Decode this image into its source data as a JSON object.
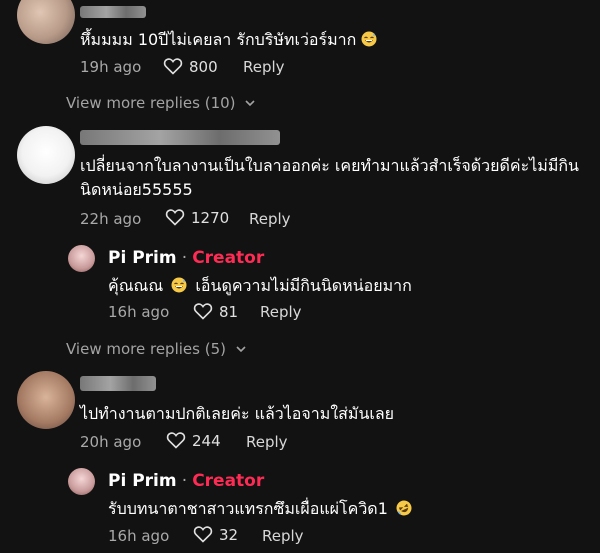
{
  "comments": [
    {
      "text": "หึ้มมมม 10ปีไม่เคยลา รักบริษัทเว่อร์มาก",
      "emoji": "grinning-sweat-emoji",
      "time": "19h ago",
      "likes": "800",
      "reply_label": "Reply"
    },
    {
      "text_line1": "เปลี่ยนจากใบลางานเป็นใบลาออกค่ะ เคยทำมาแล้วสำเร็จด้วยดีค่ะไม่มีกิน",
      "text_line2": "นิดหน่อย55555",
      "time": "22h ago",
      "likes": "1270",
      "reply_label": "Reply"
    },
    {
      "text": "ไปทำงานตามปกติเลยค่ะ แล้วไอจามใส่มันเลย",
      "time": "20h ago",
      "likes": "244",
      "reply_label": "Reply"
    }
  ],
  "view_more": [
    {
      "label": "View more replies (10)"
    },
    {
      "label": "View more replies (5)"
    }
  ],
  "creator_replies": [
    {
      "name": "Pi Prim",
      "separator": "·",
      "badge": "Creator",
      "text_before": "คุ้ณณณ",
      "emoji": "grinning-sweat-emoji",
      "text_after": "เอ็นดูความไม่มีกินนิดหน่อยมาก",
      "time": "16h ago",
      "likes": "81",
      "reply_label": "Reply"
    },
    {
      "name": "Pi Prim",
      "separator": "·",
      "badge": "Creator",
      "text": "รับบทนาตาชาสาวแทรกซึมเผื่อแผ่โควิด1",
      "emoji": "rolling-laughing-emoji",
      "time": "16h ago",
      "likes": "32",
      "reply_label": "Reply"
    }
  ],
  "colors": {
    "background": "#121212",
    "creator_badge": "#fe2c55",
    "meta": "#a9a9a9"
  }
}
